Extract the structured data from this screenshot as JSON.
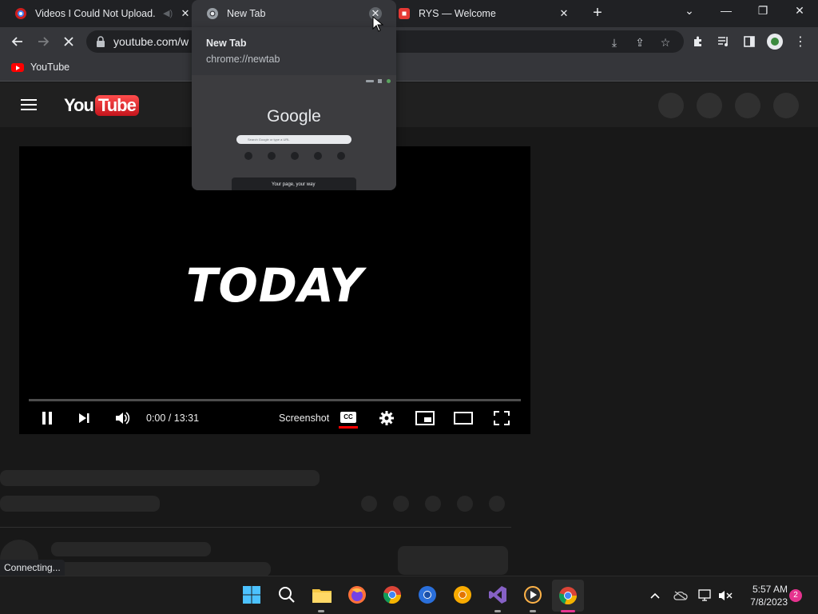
{
  "browser": {
    "tabs": [
      {
        "title": "Videos I Could Not Upload..."
      },
      {
        "title": "New Tab"
      },
      {
        "title": "RYS — Welcome"
      }
    ],
    "address": "youtube.com/w",
    "bookmarks": [
      {
        "label": "YouTube"
      }
    ]
  },
  "hover_card": {
    "title": "New Tab",
    "url": "chrome://newtab",
    "preview_brand": "Google",
    "preview_search_placeholder": "Search Google or type a URL",
    "preview_footer": "Your page, your way"
  },
  "player": {
    "overlay_text": "TODAY",
    "time": "0:00 / 13:31",
    "screenshot_label": "Screenshot",
    "cc_label": "CC"
  },
  "status": {
    "text": "Connecting..."
  },
  "taskbar": {
    "time": "5:57 AM",
    "date": "7/8/2023",
    "notifications": "2"
  },
  "colors": {
    "accent_red": "#ff0000",
    "tab_active": "#35363a",
    "notification": "#e6338f"
  }
}
